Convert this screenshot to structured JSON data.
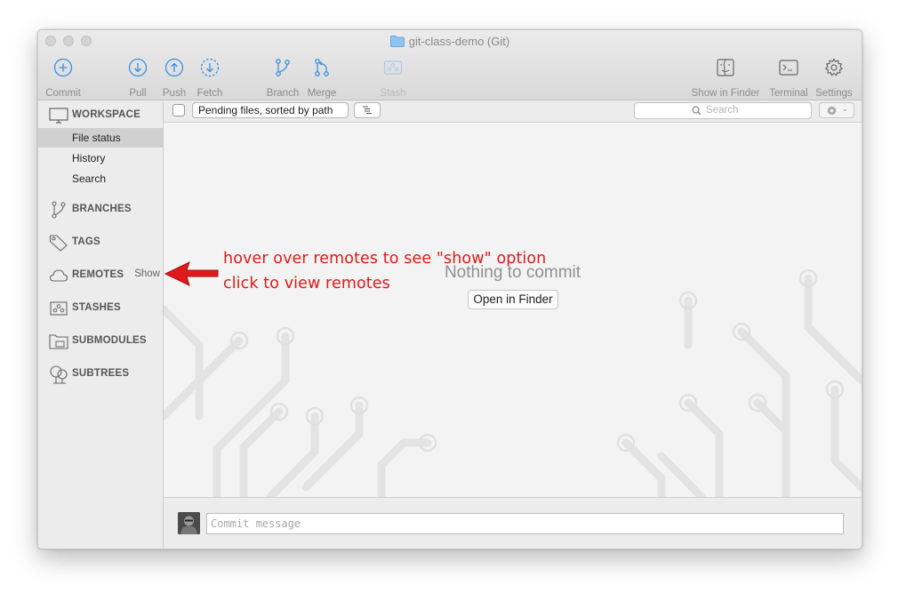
{
  "window": {
    "title": "git-class-demo (Git)",
    "accent_color": "#3b8fe0",
    "traffic_lights": [
      "close",
      "minimize",
      "zoom"
    ]
  },
  "toolbar": {
    "commit": {
      "label": "Commit",
      "icon": "plus-circle-icon"
    },
    "pull": {
      "label": "Pull",
      "icon": "arrow-down-circle-icon"
    },
    "push": {
      "label": "Push",
      "icon": "arrow-up-circle-icon"
    },
    "fetch": {
      "label": "Fetch",
      "icon": "dashed-arrow-down-circle-icon"
    },
    "branch": {
      "label": "Branch",
      "icon": "branch-icon"
    },
    "merge": {
      "label": "Merge",
      "icon": "merge-icon"
    },
    "stash": {
      "label": "Stash",
      "icon": "stash-icon",
      "disabled": true
    },
    "show_in_finder": {
      "label": "Show in Finder",
      "icon": "finder-icon"
    },
    "terminal": {
      "label": "Terminal",
      "icon": "terminal-icon"
    },
    "settings": {
      "label": "Settings",
      "icon": "gear-icon"
    }
  },
  "sidebar": {
    "workspace": {
      "label": "WORKSPACE",
      "icon": "monitor-icon",
      "items": [
        "File status",
        "History",
        "Search"
      ],
      "selected": "File status"
    },
    "branches": {
      "label": "BRANCHES",
      "icon": "branch-icon"
    },
    "tags": {
      "label": "TAGS",
      "icon": "tag-icon"
    },
    "remotes": {
      "label": "REMOTES",
      "icon": "cloud-icon",
      "hover_action": "Show"
    },
    "stashes": {
      "label": "STASHES",
      "icon": "stash-icon"
    },
    "submodules": {
      "label": "SUBMODULES",
      "icon": "submodule-folder-icon"
    },
    "subtrees": {
      "label": "SUBTREES",
      "icon": "tree-icon"
    }
  },
  "filter_bar": {
    "sort_option": "Pending files, sorted by path",
    "search_placeholder": "Search",
    "view_icon": "list-view-icon",
    "options_icon": "gear-icon"
  },
  "main": {
    "empty_message": "Nothing to commit",
    "open_in_finder_label": "Open in Finder"
  },
  "commit_bar": {
    "placeholder": "Commit message",
    "avatar": "user-avatar"
  },
  "annotations": {
    "line1": "hover over remotes to see \"show\" option",
    "line2": "click to view remotes",
    "color": "#e01a1a"
  }
}
